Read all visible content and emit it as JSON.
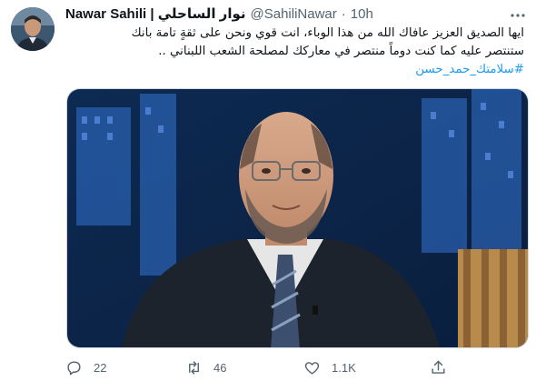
{
  "author": {
    "display_name": "Nawar Sahili | نوار الساحلي",
    "handle": "@SahiliNawar",
    "separator": "·",
    "time": "10h"
  },
  "tweet": {
    "lines": [
      "ايها الصديق العزيز عافاك الله من هذا الوباء، انت قوي ونحن على ثقةٍ تامة بانك",
      "ستنتصر عليه كما كنت دوماً منتصر في معاركك لمصلحة الشعب اللبناني .."
    ],
    "hashtag": "#سلامتك_حمد_حسن"
  },
  "actions": {
    "reply_count": "22",
    "retweet_count": "46",
    "like_count": "1.1K"
  },
  "icons": {
    "more": "more-horizontal-icon",
    "reply": "reply-icon",
    "retweet": "retweet-icon",
    "like": "heart-icon",
    "share": "share-icon"
  },
  "colors": {
    "text": "#0f1419",
    "secondary": "#536471",
    "link": "#1d9bf0",
    "border": "#cfd9de"
  }
}
